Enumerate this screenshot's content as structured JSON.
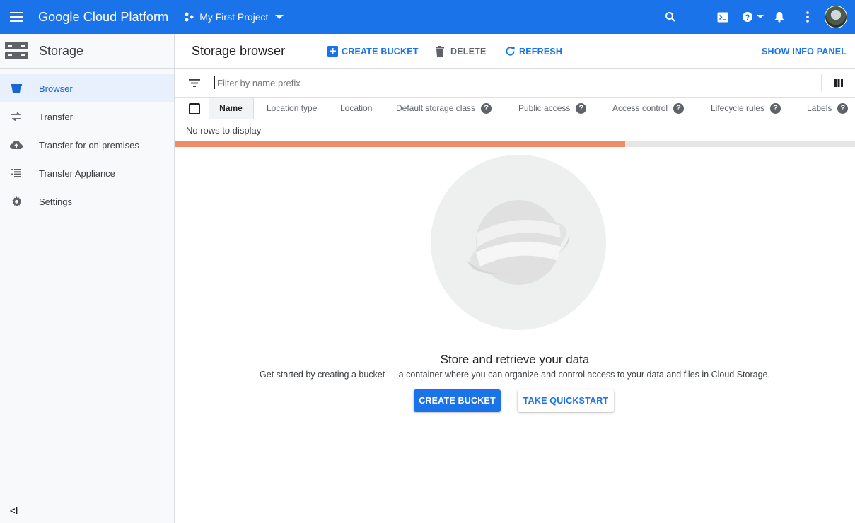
{
  "topbar": {
    "brand": "Google Cloud Platform",
    "project": "My First Project",
    "bg_color": "#1a73e8"
  },
  "sidebar": {
    "title": "Storage",
    "items": [
      {
        "label": "Browser",
        "icon": "bucket-icon",
        "active": true
      },
      {
        "label": "Transfer",
        "icon": "swap-arrows-icon",
        "active": false
      },
      {
        "label": "Transfer for on-premises",
        "icon": "cloud-upload-icon",
        "active": false
      },
      {
        "label": "Transfer Appliance",
        "icon": "list-icon",
        "active": false
      },
      {
        "label": "Settings",
        "icon": "gear-icon",
        "active": false
      }
    ],
    "collapse_label": "<I"
  },
  "toolbar": {
    "title": "Storage browser",
    "create_bucket": "CREATE BUCKET",
    "delete": "DELETE",
    "refresh": "REFRESH",
    "show_info_panel": "SHOW INFO PANEL"
  },
  "filter": {
    "placeholder": "Filter by name prefix"
  },
  "table": {
    "columns": [
      {
        "label": "Name",
        "help": false
      },
      {
        "label": "Location type",
        "help": false
      },
      {
        "label": "Location",
        "help": false
      },
      {
        "label": "Default storage class",
        "help": true
      },
      {
        "label": "Public access",
        "help": true
      },
      {
        "label": "Access control",
        "help": true
      },
      {
        "label": "Lifecycle rules",
        "help": true
      },
      {
        "label": "Labels",
        "help": true
      }
    ],
    "empty_text": "No rows to display",
    "help_glyph": "?"
  },
  "progress": {
    "fraction": 0.662,
    "color": "#ef8c66"
  },
  "empty_state": {
    "title": "Store and retrieve your data",
    "description": "Get started by creating a bucket — a container where you can organize and control access to your data and files in Cloud Storage.",
    "primary_button": "CREATE BUCKET",
    "secondary_button": "TAKE QUICKSTART"
  }
}
